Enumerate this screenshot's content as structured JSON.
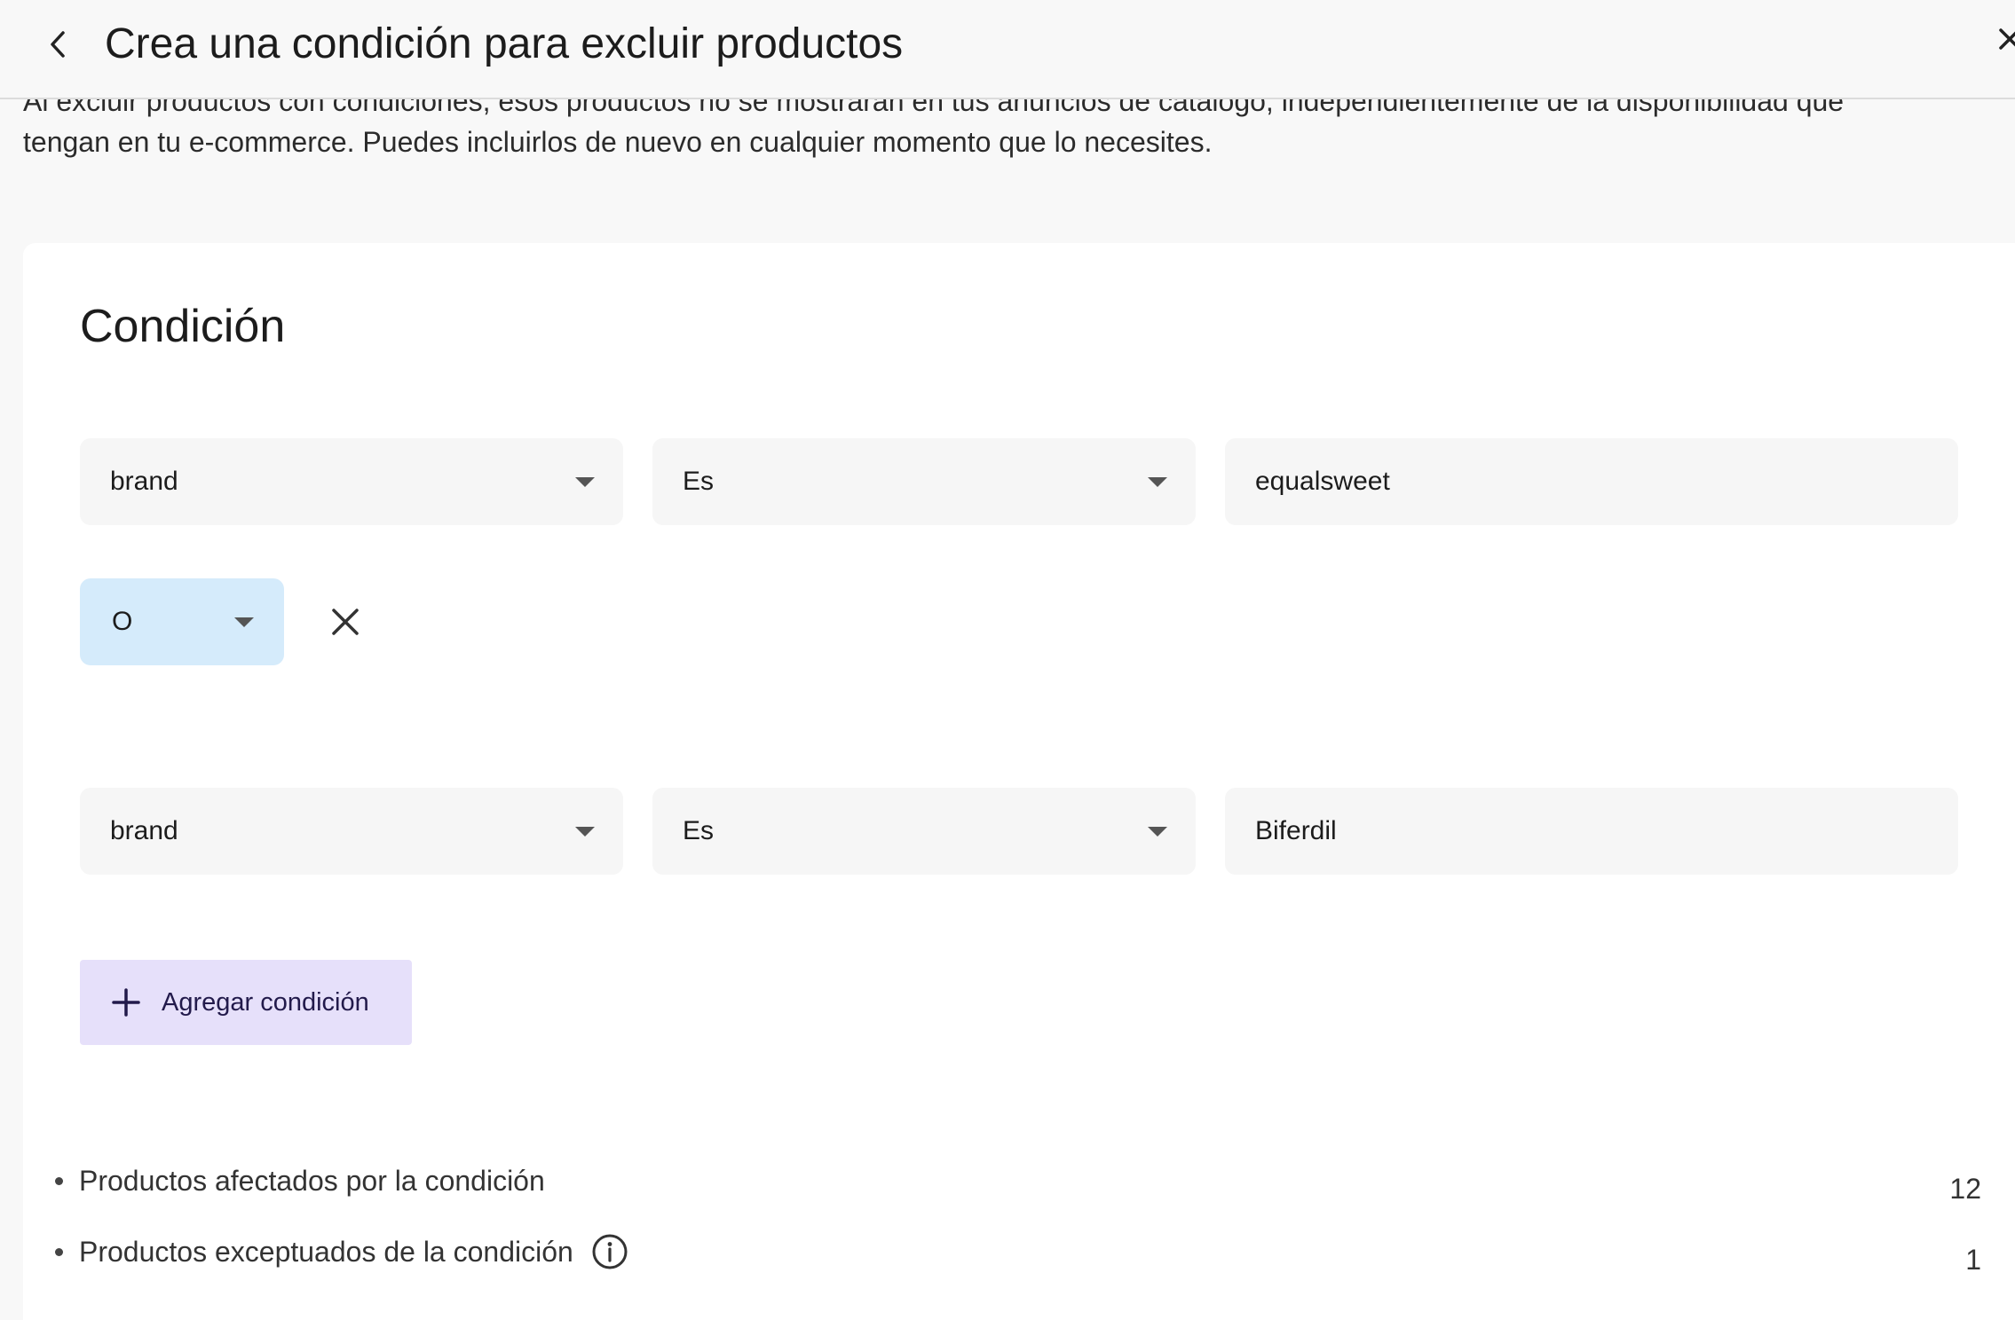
{
  "header": {
    "title": "Crea una condición para excluir productos"
  },
  "intro": {
    "line1": "Al excluir productos con condiciones, esos productos no se mostrarán en tus anuncios de catálogo, independientemente de la disponibilidad que",
    "line2": "tengan en tu e-commerce. Puedes incluirlos de nuevo en cualquier momento que lo necesites."
  },
  "condition": {
    "title": "Condición",
    "rows": [
      {
        "field": "brand",
        "operator": "Es",
        "value": "equalsweet"
      },
      {
        "field": "brand",
        "operator": "Es",
        "value": "Biferdil"
      }
    ],
    "logic_operator": "O",
    "add_label": "Agregar condición"
  },
  "stats": {
    "affected_label": "Productos afectados por la condición",
    "affected_count": "12",
    "excepted_label": "Productos exceptuados de la condición",
    "excepted_count": "1"
  },
  "colors": {
    "logic_bg": "#d5ebfb",
    "add_bg": "#e6e0fa",
    "field_bg": "#f6f6f6"
  }
}
